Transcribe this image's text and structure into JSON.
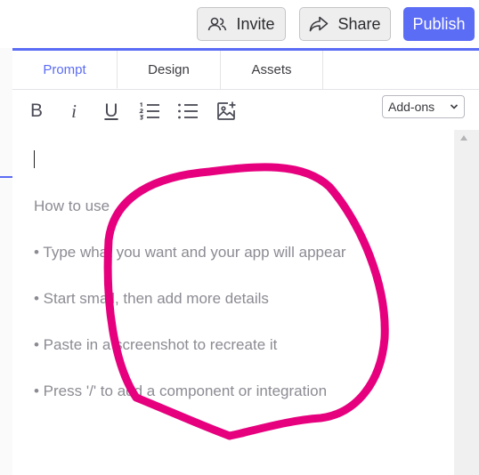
{
  "header": {
    "invite_label": "Invite",
    "share_label": "Share",
    "publish_label": "Publish"
  },
  "tabs": [
    {
      "label": "Prompt",
      "active": true
    },
    {
      "label": "Design",
      "active": false
    },
    {
      "label": "Assets",
      "active": false
    }
  ],
  "toolbar": {
    "bold_label": "B",
    "italic_label": "i",
    "underline_label": "U",
    "icons": [
      "bold-icon",
      "italic-icon",
      "underline-icon",
      "ordered-list-icon",
      "bullet-list-icon",
      "add-image-icon"
    ],
    "addons_label": "Add-ons"
  },
  "editor": {
    "hint_title": "How to use",
    "bullets": [
      "• Type what you want and your app will appear",
      "• Start small, then add more details",
      "• Paste in a screenshot to recreate it",
      "• Press '/' to add a component or integration"
    ]
  },
  "colors": {
    "accent": "#5b6cf5",
    "annotation": "#e6007e",
    "hint_text": "#8b8b93"
  }
}
